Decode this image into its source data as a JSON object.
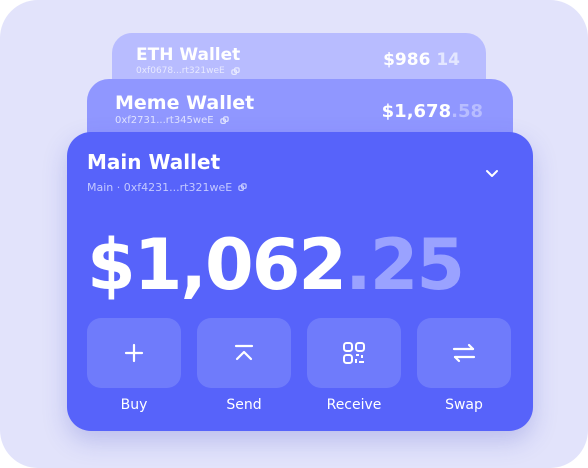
{
  "wallets": [
    {
      "name": "ETH Wallet",
      "address": "0xf0678...rt321weE",
      "amount_whole": "$986",
      "amount_cents": "14"
    },
    {
      "name": "Meme Wallet",
      "address": "0xf2731...rt345weE",
      "amount_whole": "$1,678",
      "amount_cents": ".58"
    }
  ],
  "main_wallet": {
    "name": "Main Wallet",
    "address": "Main · 0xf4231...rt321weE",
    "balance_whole": "$1,062",
    "balance_cents": ".25"
  },
  "actions": [
    {
      "label": "Buy",
      "icon": "plus-icon"
    },
    {
      "label": "Send",
      "icon": "send-up-icon"
    },
    {
      "label": "Receive",
      "icon": "qr-code-icon"
    },
    {
      "label": "Swap",
      "icon": "swap-arrows-icon"
    }
  ],
  "colors": {
    "background": "#e2e3fb",
    "card_back": "#b8bcff",
    "card_mid": "#9097ff",
    "card_main": "#5763fa",
    "action_button": "#6f7bfb"
  }
}
